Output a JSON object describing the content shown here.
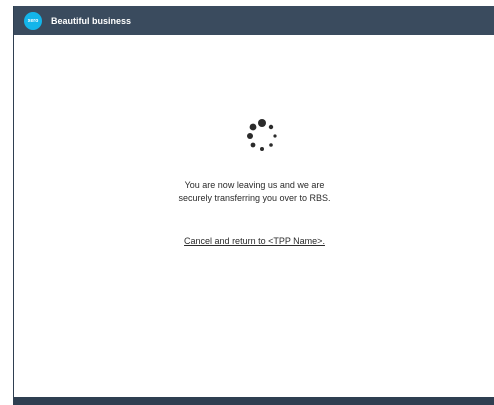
{
  "header": {
    "logo_text": "xero",
    "org_name": "Beautiful business"
  },
  "main": {
    "message_line1": "You are now leaving us and we are",
    "message_line2": "securely transferring you over to RBS.",
    "cancel_link": "Cancel and return to <TPP Name>."
  },
  "colors": {
    "header_bg": "#3a4b5e",
    "brand": "#13b5ea",
    "spinner": "#2b2b2b"
  },
  "icons": {
    "spinner": "loading-spinner-icon"
  }
}
